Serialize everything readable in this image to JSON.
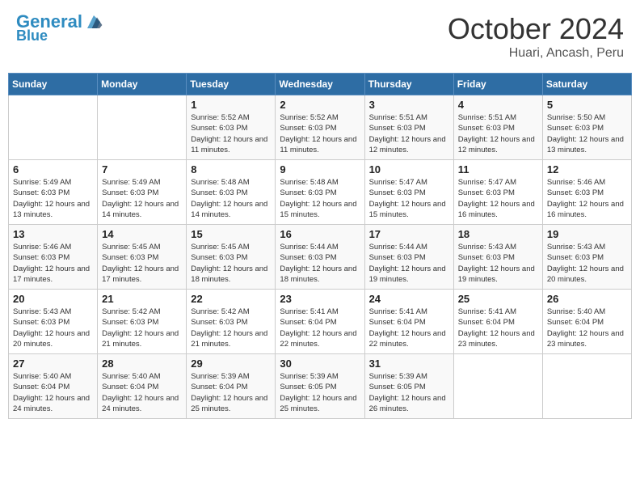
{
  "header": {
    "logo_line1": "General",
    "logo_line2": "Blue",
    "title": "October 2024",
    "subtitle": "Huari, Ancash, Peru"
  },
  "days_of_week": [
    "Sunday",
    "Monday",
    "Tuesday",
    "Wednesday",
    "Thursday",
    "Friday",
    "Saturday"
  ],
  "weeks": [
    [
      {
        "day": "",
        "info": ""
      },
      {
        "day": "",
        "info": ""
      },
      {
        "day": "1",
        "info": "Sunrise: 5:52 AM\nSunset: 6:03 PM\nDaylight: 12 hours and 11 minutes."
      },
      {
        "day": "2",
        "info": "Sunrise: 5:52 AM\nSunset: 6:03 PM\nDaylight: 12 hours and 11 minutes."
      },
      {
        "day": "3",
        "info": "Sunrise: 5:51 AM\nSunset: 6:03 PM\nDaylight: 12 hours and 12 minutes."
      },
      {
        "day": "4",
        "info": "Sunrise: 5:51 AM\nSunset: 6:03 PM\nDaylight: 12 hours and 12 minutes."
      },
      {
        "day": "5",
        "info": "Sunrise: 5:50 AM\nSunset: 6:03 PM\nDaylight: 12 hours and 13 minutes."
      }
    ],
    [
      {
        "day": "6",
        "info": "Sunrise: 5:49 AM\nSunset: 6:03 PM\nDaylight: 12 hours and 13 minutes."
      },
      {
        "day": "7",
        "info": "Sunrise: 5:49 AM\nSunset: 6:03 PM\nDaylight: 12 hours and 14 minutes."
      },
      {
        "day": "8",
        "info": "Sunrise: 5:48 AM\nSunset: 6:03 PM\nDaylight: 12 hours and 14 minutes."
      },
      {
        "day": "9",
        "info": "Sunrise: 5:48 AM\nSunset: 6:03 PM\nDaylight: 12 hours and 15 minutes."
      },
      {
        "day": "10",
        "info": "Sunrise: 5:47 AM\nSunset: 6:03 PM\nDaylight: 12 hours and 15 minutes."
      },
      {
        "day": "11",
        "info": "Sunrise: 5:47 AM\nSunset: 6:03 PM\nDaylight: 12 hours and 16 minutes."
      },
      {
        "day": "12",
        "info": "Sunrise: 5:46 AM\nSunset: 6:03 PM\nDaylight: 12 hours and 16 minutes."
      }
    ],
    [
      {
        "day": "13",
        "info": "Sunrise: 5:46 AM\nSunset: 6:03 PM\nDaylight: 12 hours and 17 minutes."
      },
      {
        "day": "14",
        "info": "Sunrise: 5:45 AM\nSunset: 6:03 PM\nDaylight: 12 hours and 17 minutes."
      },
      {
        "day": "15",
        "info": "Sunrise: 5:45 AM\nSunset: 6:03 PM\nDaylight: 12 hours and 18 minutes."
      },
      {
        "day": "16",
        "info": "Sunrise: 5:44 AM\nSunset: 6:03 PM\nDaylight: 12 hours and 18 minutes."
      },
      {
        "day": "17",
        "info": "Sunrise: 5:44 AM\nSunset: 6:03 PM\nDaylight: 12 hours and 19 minutes."
      },
      {
        "day": "18",
        "info": "Sunrise: 5:43 AM\nSunset: 6:03 PM\nDaylight: 12 hours and 19 minutes."
      },
      {
        "day": "19",
        "info": "Sunrise: 5:43 AM\nSunset: 6:03 PM\nDaylight: 12 hours and 20 minutes."
      }
    ],
    [
      {
        "day": "20",
        "info": "Sunrise: 5:43 AM\nSunset: 6:03 PM\nDaylight: 12 hours and 20 minutes."
      },
      {
        "day": "21",
        "info": "Sunrise: 5:42 AM\nSunset: 6:03 PM\nDaylight: 12 hours and 21 minutes."
      },
      {
        "day": "22",
        "info": "Sunrise: 5:42 AM\nSunset: 6:03 PM\nDaylight: 12 hours and 21 minutes."
      },
      {
        "day": "23",
        "info": "Sunrise: 5:41 AM\nSunset: 6:04 PM\nDaylight: 12 hours and 22 minutes."
      },
      {
        "day": "24",
        "info": "Sunrise: 5:41 AM\nSunset: 6:04 PM\nDaylight: 12 hours and 22 minutes."
      },
      {
        "day": "25",
        "info": "Sunrise: 5:41 AM\nSunset: 6:04 PM\nDaylight: 12 hours and 23 minutes."
      },
      {
        "day": "26",
        "info": "Sunrise: 5:40 AM\nSunset: 6:04 PM\nDaylight: 12 hours and 23 minutes."
      }
    ],
    [
      {
        "day": "27",
        "info": "Sunrise: 5:40 AM\nSunset: 6:04 PM\nDaylight: 12 hours and 24 minutes."
      },
      {
        "day": "28",
        "info": "Sunrise: 5:40 AM\nSunset: 6:04 PM\nDaylight: 12 hours and 24 minutes."
      },
      {
        "day": "29",
        "info": "Sunrise: 5:39 AM\nSunset: 6:04 PM\nDaylight: 12 hours and 25 minutes."
      },
      {
        "day": "30",
        "info": "Sunrise: 5:39 AM\nSunset: 6:05 PM\nDaylight: 12 hours and 25 minutes."
      },
      {
        "day": "31",
        "info": "Sunrise: 5:39 AM\nSunset: 6:05 PM\nDaylight: 12 hours and 26 minutes."
      },
      {
        "day": "",
        "info": ""
      },
      {
        "day": "",
        "info": ""
      }
    ]
  ]
}
